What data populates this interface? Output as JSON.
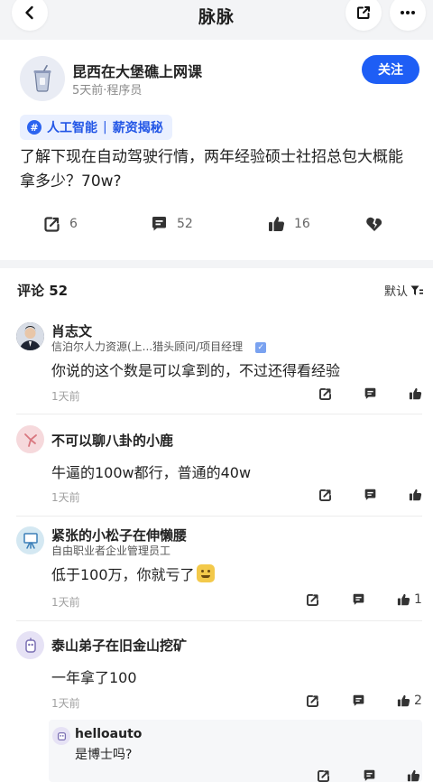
{
  "header": {
    "title": "脉脉"
  },
  "post": {
    "author": {
      "name": "昆西在大堡礁上网课",
      "meta": "5天前·程序员"
    },
    "follow_label": "关注",
    "topic": {
      "left": "人工智能",
      "separator": "|",
      "right": "薪资揭秘"
    },
    "body": "了解下现在自动驾驶行情，两年经验硕士社招总包大概能拿多少？70w?",
    "actions": {
      "share_count": "6",
      "comment_count": "52",
      "like_count": "16"
    }
  },
  "comments_header": {
    "title": "评论 52",
    "sort_label": "默认"
  },
  "comments": [
    {
      "name": "肖志文",
      "subtitle": "信泊尔人力资源(上...猎头顾问/项目经理",
      "text": "你说的这个数是可以拿到的，不过还得看经验",
      "time": "1天前",
      "likes": ""
    },
    {
      "name": "不可以聊八卦的小鹿",
      "subtitle": "",
      "text": "牛逼的100w都行，普通的40w",
      "time": "1天前",
      "likes": ""
    },
    {
      "name": "紧张的小松子在伸懒腰",
      "subtitle": "自由职业者企业管理员工",
      "text": "低于100万，你就亏了",
      "time": "1天前",
      "likes": "1"
    },
    {
      "name": "泰山弟子在旧金山挖矿",
      "subtitle": "",
      "text": "一年拿了100",
      "time": "1天前",
      "likes": "2"
    }
  ],
  "reply": {
    "name": "helloauto",
    "text": "是博士吗?"
  },
  "colors": {
    "accent": "#1e5ef5",
    "tag_bg": "#eaf0ff",
    "tag_text": "#2457e6"
  }
}
